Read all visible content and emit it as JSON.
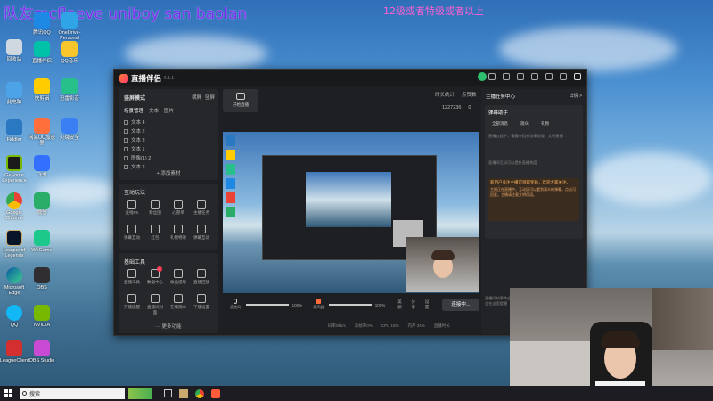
{
  "overlay": {
    "title": "队友mcflaeve uniboy san baolan",
    "subtitle": "12级或者特级或者以上"
  },
  "desktop_icons": [
    {
      "label": "回收站"
    },
    {
      "label": "腾讯QQ"
    },
    {
      "label": "OneDrive-Personal"
    },
    {
      "label": "此电脑"
    },
    {
      "label": "直播伴侣"
    },
    {
      "label": "QQ音乐"
    },
    {
      "label": "Fiddler"
    },
    {
      "label": "快剪辑"
    },
    {
      "label": "迅雷影音"
    },
    {
      "label": "网易UU加速器"
    },
    {
      "label": "火绒安全"
    },
    {
      "label": "酷狗"
    },
    {
      "label": "GeForce Experience"
    },
    {
      "label": "飞书"
    },
    {
      "label": "Google Chrome"
    },
    {
      "label": "微信"
    },
    {
      "label": "League of Legends"
    },
    {
      "label": "WeGame"
    },
    {
      "label": "Microsoft Edge"
    },
    {
      "label": "OBS"
    },
    {
      "label": "QQ"
    },
    {
      "label": "NVIDIA"
    },
    {
      "label": "LeagueClient"
    },
    {
      "label": "OBS Studio"
    }
  ],
  "app": {
    "name": "直播伴侣",
    "version": "6.1.1",
    "left": {
      "scene_mode": "竖屏模式",
      "tabs": [
        "横屏",
        "竖屏"
      ],
      "source_header": "场景管理",
      "source_sub": [
        "文本",
        "图片"
      ],
      "sources": [
        "文本 4",
        "文本 2",
        "文本 3",
        "文本 1",
        "图像(1) 2",
        "文本 2"
      ],
      "add_source": "+ 添加素材",
      "interact_title": "互动玩法",
      "interact_tools": [
        "连线PK",
        "粉丝团",
        "心愿单",
        "主播任务",
        "弹幕互动",
        "红包",
        "礼物特效",
        "弹幕互动"
      ],
      "basic_title": "基础工具",
      "basic_tools": [
        "直播工具",
        "数据中心",
        "收益提现",
        "直播回放",
        "开播提醒",
        "直播间封面",
        "在线观众",
        "下播设置"
      ],
      "more": "··· 更多功能",
      "badge_count": "4"
    },
    "top": {
      "start_label": "开始直播",
      "stats": [
        "时长统计",
        "点赞数"
      ],
      "counts": [
        "1227236",
        "0"
      ]
    },
    "bottom": {
      "mic_label": "麦克风",
      "mic_volume": "100%",
      "speaker_label": "扬声器",
      "speaker_volume": "100%",
      "buttons": [
        "美颜",
        "分享",
        "设置"
      ],
      "live_button": "连接中..."
    },
    "status_bar": [
      "码率0kb/s",
      "丢帧率0%",
      "CPU 15%",
      "内存 34%",
      "直播时长"
    ],
    "right": {
      "title": "主播任务中心",
      "more": "详情 >",
      "ai_title": "弹幕助手",
      "tabs": [
        "全部消息",
        "观众",
        "礼物"
      ],
      "notice_1": "直播过程中，请遵守相关法律法规，文明直播",
      "notice_2": "直播间互动可以提升直播热度",
      "highlight": "新用户关注主播可领取奖励，欢迎大家关注。",
      "highlight_body": "主播正在直播中，互动区可以看到观众的弹幕，点击可回复。主播请注意文明用语。",
      "foot": "直播间的事件会在这里出现，有人送了礼物或关注了主播会在这里提醒"
    }
  },
  "taskbar": {
    "search_placeholder": "搜索"
  },
  "colors": {
    "overlay_title": "#7c2cf0",
    "overlay_sub": "#ff5fd2",
    "live_button_bg": "#3a3b40",
    "accent_red": "#ff3b57",
    "highlight_bg": "#3a2c1e"
  }
}
